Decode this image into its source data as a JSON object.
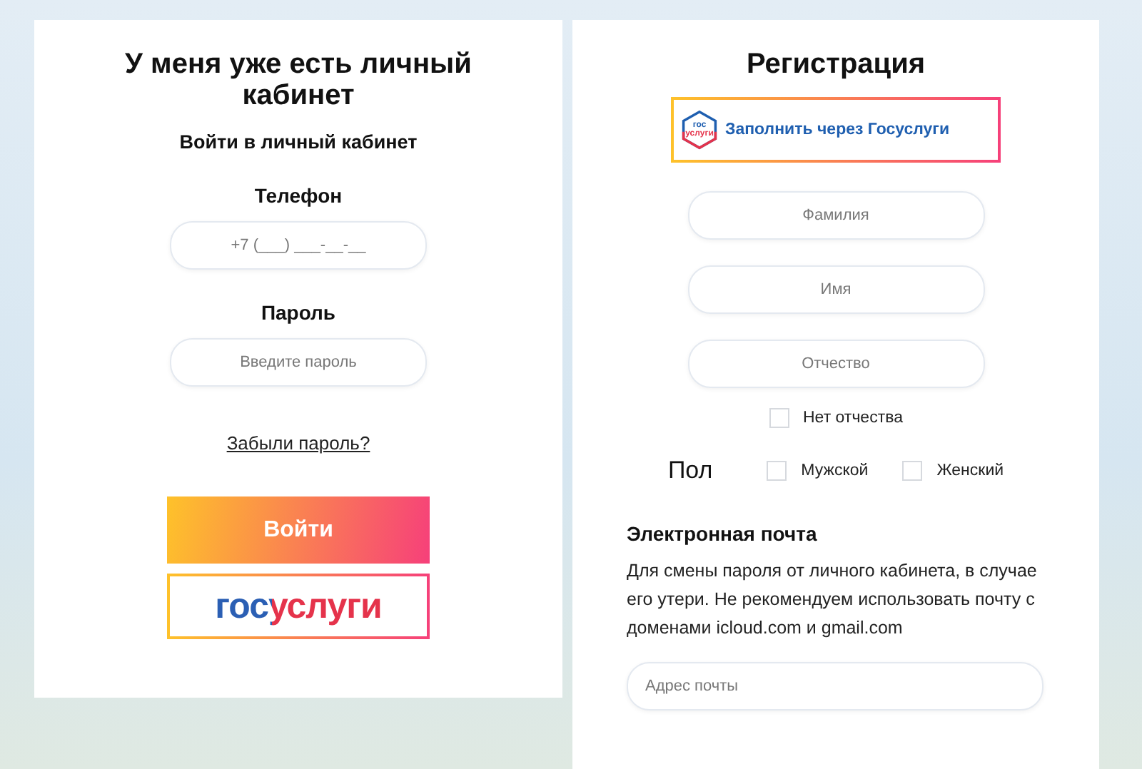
{
  "login": {
    "title": "У меня уже есть личный кабинет",
    "subtitle": "Войти в личный кабинет",
    "phone": {
      "label": "Телефон",
      "placeholder": "+7 (___) ___-__-__"
    },
    "password": {
      "label": "Пароль",
      "placeholder": "Введите пароль"
    },
    "forgot_link": "Забыли пароль?",
    "submit_button": "Войти",
    "gosuslugi_button": "госуслуги"
  },
  "registration": {
    "title": "Регистрация",
    "gosuslugi_button": {
      "logo_lines": [
        "гос",
        "услуги"
      ],
      "label": "Заполнить через Госуслуги"
    },
    "fields": [
      {
        "placeholder": "Фамилия"
      },
      {
        "placeholder": "Имя"
      },
      {
        "placeholder": "Отчество"
      }
    ],
    "no_patronymic": {
      "label": "Нет отчества",
      "checked": false
    },
    "gender": {
      "label": "Пол",
      "options": [
        {
          "label": "Мужской",
          "checked": false
        },
        {
          "label": "Женский",
          "checked": false
        }
      ]
    },
    "email": {
      "heading": "Электронная почта",
      "note": "Для смены пароля от личного кабинета, в случае его утери. Не рекомендуем использовать почту с доменами icloud.com и gmail.com",
      "placeholder": "Адрес почты"
    }
  }
}
